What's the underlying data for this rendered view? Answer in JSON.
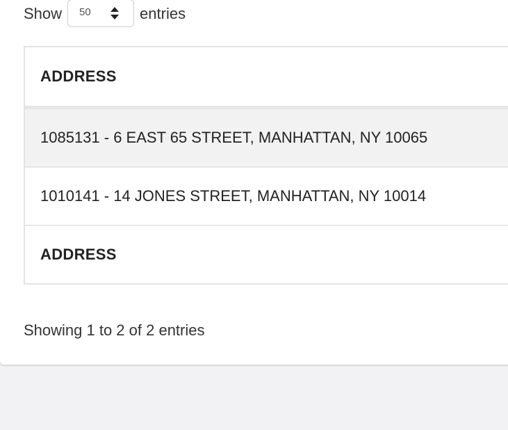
{
  "length_control": {
    "show_label": "Show",
    "selected_value": "50",
    "entries_label": "entries"
  },
  "table": {
    "header": [
      "ADDRESS"
    ],
    "rows": [
      [
        "1085131 - 6 EAST 65 STREET, MANHATTAN, NY 10065"
      ],
      [
        "1010141 - 14 JONES STREET, MANHATTAN, NY 10014"
      ]
    ],
    "footer": [
      "ADDRESS"
    ]
  },
  "info_text": "Showing 1 to 2 of 2 entries",
  "colors": {
    "page_background": "#f2f2f4",
    "card_background": "#ffffff",
    "striped_row": "#f2f2f2",
    "border": "#e3e3e3"
  },
  "icons": {
    "select_chevron": "sort-updown-icon"
  }
}
